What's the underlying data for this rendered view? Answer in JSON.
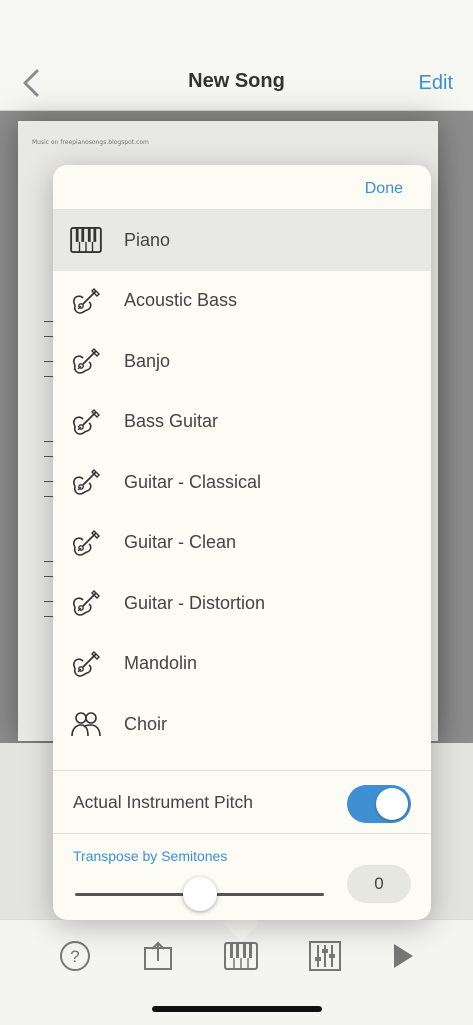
{
  "nav": {
    "title": "New Song",
    "edit_label": "Edit"
  },
  "sheet": {
    "credit": "Music on freepianosongs.blogspot.com"
  },
  "popover": {
    "done_label": "Done",
    "instruments": [
      {
        "label": "Piano",
        "icon": "piano-keys-icon",
        "selected": true
      },
      {
        "label": "Acoustic Bass",
        "icon": "guitar-icon",
        "selected": false
      },
      {
        "label": "Banjo",
        "icon": "guitar-icon",
        "selected": false
      },
      {
        "label": "Bass Guitar",
        "icon": "guitar-icon",
        "selected": false
      },
      {
        "label": "Guitar - Classical",
        "icon": "guitar-icon",
        "selected": false
      },
      {
        "label": "Guitar - Clean",
        "icon": "guitar-icon",
        "selected": false
      },
      {
        "label": "Guitar - Distortion",
        "icon": "guitar-icon",
        "selected": false
      },
      {
        "label": "Mandolin",
        "icon": "guitar-icon",
        "selected": false
      },
      {
        "label": "Choir",
        "icon": "people-icon",
        "selected": false
      }
    ],
    "pitch": {
      "label": "Actual Instrument Pitch",
      "on": true
    },
    "transpose": {
      "label": "Transpose by Semitones",
      "value": "0",
      "slider_fraction": 0.5
    }
  },
  "toolbar": {
    "icons": [
      "help-icon",
      "share-icon",
      "piano-keys-icon",
      "mixer-icon",
      "play-icon"
    ]
  },
  "colors": {
    "accent": "#3b8fd4",
    "toggle_on": "#3f90d2"
  }
}
